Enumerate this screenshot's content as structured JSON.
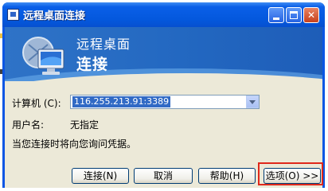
{
  "window": {
    "title": "远程桌面连接",
    "controls": {
      "minimize": "minimize",
      "maximize": "maximize",
      "close": "✕"
    }
  },
  "banner": {
    "line1": "远程桌面",
    "line2": "连接"
  },
  "form": {
    "computer_label": "计算机",
    "computer_access": "(C):",
    "computer_value": "116.255.213.91:3389",
    "username_label": "用户名:",
    "username_value": "无指定",
    "prompt_text": "当您连接时将向您询问凭据。"
  },
  "buttons": {
    "connect": "连接(N)",
    "cancel": "取消",
    "help": "帮助(H)",
    "options": "选项(O) >>"
  },
  "colors": {
    "titlebar": "#0a5fe8",
    "banner": "#2368c1",
    "client": "#ece9d8",
    "highlight": "#e0281b",
    "selection": "#316ac5"
  },
  "icons": [
    "app-icon",
    "monitor-icon",
    "dropdown-arrow-icon"
  ]
}
